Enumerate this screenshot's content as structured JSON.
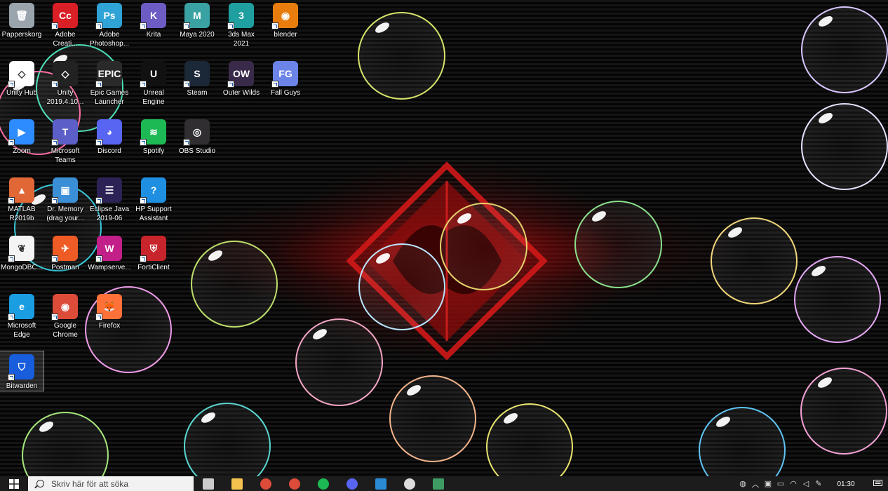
{
  "desktop_icons": [
    {
      "label": "Papperskorg",
      "icon": "recycle-bin-icon",
      "color": "#9aa4ad",
      "glyph": "🗑"
    },
    {
      "label": "Adobe\nCreati...",
      "icon": "adobe-cc-icon",
      "color": "#da1f26",
      "glyph": "Cc"
    },
    {
      "label": "Adobe\nPhotoshop...",
      "icon": "photoshop-icon",
      "color": "#2fa3d6",
      "glyph": "Ps"
    },
    {
      "label": "Krita",
      "icon": "krita-icon",
      "color": "#6d5cc4",
      "glyph": "K"
    },
    {
      "label": "Maya 2020",
      "icon": "maya-icon",
      "color": "#3aa2a3",
      "glyph": "M"
    },
    {
      "label": "3ds Max 2021",
      "icon": "3dsmax-icon",
      "color": "#1f9f9f",
      "glyph": "3"
    },
    {
      "label": "blender",
      "icon": "blender-icon",
      "color": "#e87d0d",
      "glyph": "◉"
    },
    {
      "label": "Unity Hub",
      "icon": "unity-hub-icon",
      "color": "#ffffff",
      "glyph": "◇"
    },
    {
      "label": "Unity\n2019.4.10...",
      "icon": "unity-icon",
      "color": "#222222",
      "glyph": "◇"
    },
    {
      "label": "Epic Games\nLauncher",
      "icon": "epic-games-icon",
      "color": "#2a2a2a",
      "glyph": "EPIC"
    },
    {
      "label": "Unreal\nEngine",
      "icon": "unreal-engine-icon",
      "color": "#111111",
      "glyph": "U"
    },
    {
      "label": "Steam",
      "icon": "steam-icon",
      "color": "#1b2838",
      "glyph": "S"
    },
    {
      "label": "Outer Wilds",
      "icon": "outer-wilds-icon",
      "color": "#3a2a4a",
      "glyph": "OW"
    },
    {
      "label": "Fall Guys",
      "icon": "fall-guys-icon",
      "color": "#6c84e8",
      "glyph": "FG"
    },
    {
      "label": "Zoom",
      "icon": "zoom-icon",
      "color": "#2d8cff",
      "glyph": "▶"
    },
    {
      "label": "Microsoft\nTeams",
      "icon": "teams-icon",
      "color": "#5b5fc7",
      "glyph": "T"
    },
    {
      "label": "Discord",
      "icon": "discord-icon",
      "color": "#5865f2",
      "glyph": "◕"
    },
    {
      "label": "Spotify",
      "icon": "spotify-icon",
      "color": "#1db954",
      "glyph": "≋"
    },
    {
      "label": "OBS Studio",
      "icon": "obs-icon",
      "color": "#302e31",
      "glyph": "◎"
    },
    {
      "label": "MATLAB\nR2019b",
      "icon": "matlab-icon",
      "color": "#e16737",
      "glyph": "▲"
    },
    {
      "label": "Dr. Memory\n(drag your...",
      "icon": "dr-memory-icon",
      "color": "#3b8fd6",
      "glyph": "▣"
    },
    {
      "label": "Eclipse Java\n2019-06",
      "icon": "eclipse-icon",
      "color": "#2c2255",
      "glyph": "☰"
    },
    {
      "label": "HP Support\nAssistant",
      "icon": "hp-support-icon",
      "color": "#1e8fe1",
      "glyph": "?"
    },
    {
      "label": "MongoDBC...",
      "icon": "mongodb-icon",
      "color": "#f4f4f4",
      "glyph": "❦"
    },
    {
      "label": "Postman",
      "icon": "postman-icon",
      "color": "#ef5b25",
      "glyph": "✈"
    },
    {
      "label": "Wampserve...",
      "icon": "wampserver-icon",
      "color": "#c21f88",
      "glyph": "W"
    },
    {
      "label": "FortiClient",
      "icon": "forticlient-icon",
      "color": "#c8242b",
      "glyph": "⛨"
    },
    {
      "label": "Microsoft\nEdge",
      "icon": "edge-icon",
      "color": "#1b9de2",
      "glyph": "e"
    },
    {
      "label": "Google\nChrome",
      "icon": "chrome-icon",
      "color": "#dd4b39",
      "glyph": "◉"
    },
    {
      "label": "Firefox",
      "icon": "firefox-icon",
      "color": "#ff7139",
      "glyph": "🦊"
    },
    {
      "label": "Bitwarden",
      "icon": "bitwarden-icon",
      "color": "#175ddc",
      "glyph": "⛉"
    }
  ],
  "taskbar": {
    "search_placeholder": "Skriv här för att söka",
    "apps": [
      {
        "name": "task-view",
        "color": "#cccccc"
      },
      {
        "name": "file-explorer",
        "color": "#f2c14e"
      },
      {
        "name": "chrome",
        "color": "#dd4b39"
      },
      {
        "name": "chrome-2",
        "color": "#dd4b39"
      },
      {
        "name": "spotify",
        "color": "#1db954"
      },
      {
        "name": "discord",
        "color": "#5865f2"
      },
      {
        "name": "vscode",
        "color": "#2a8ad4"
      },
      {
        "name": "settings",
        "color": "#dddddd"
      },
      {
        "name": "app-window",
        "color": "#3d9b63"
      }
    ],
    "clock_time": "01:30"
  }
}
